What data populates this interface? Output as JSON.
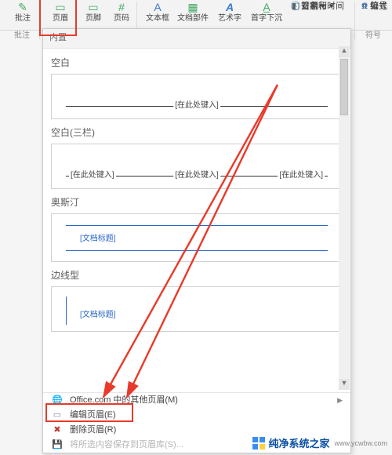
{
  "ribbon": {
    "annotate_label": "批注",
    "header_label": "页眉",
    "footer_label": "页脚",
    "pagenum_label": "页码",
    "textbox_label": "文本框",
    "parts_label": "文档部件",
    "wordart_label": "艺术字",
    "dropcap_label": "首字下沉",
    "signature_label": "签名行",
    "datetime_label": "日期和时间",
    "object_label": "对象",
    "equation_label": "公式",
    "symbol_label": "符号",
    "number_label": "编号",
    "group_comments": "批注",
    "group_symbols": "符号"
  },
  "dropdown": {
    "builtins_label": "内置",
    "sections": {
      "blank": "空白",
      "blank3": "空白(三栏)",
      "austin": "奥斯汀",
      "sideline": "边线型"
    },
    "placeholder": "[在此处键入]",
    "doc_title": "[文档标题]",
    "more_office": "Office.com 中的其他页眉(M)",
    "edit_header": "编辑页眉(E)",
    "remove_header": "删除页眉(R)",
    "save_to_gallery": "将所选内容保存到页眉库(S)..."
  },
  "watermark": {
    "brand": "纯净系统之家",
    "url": "www.ycwbw.com"
  }
}
